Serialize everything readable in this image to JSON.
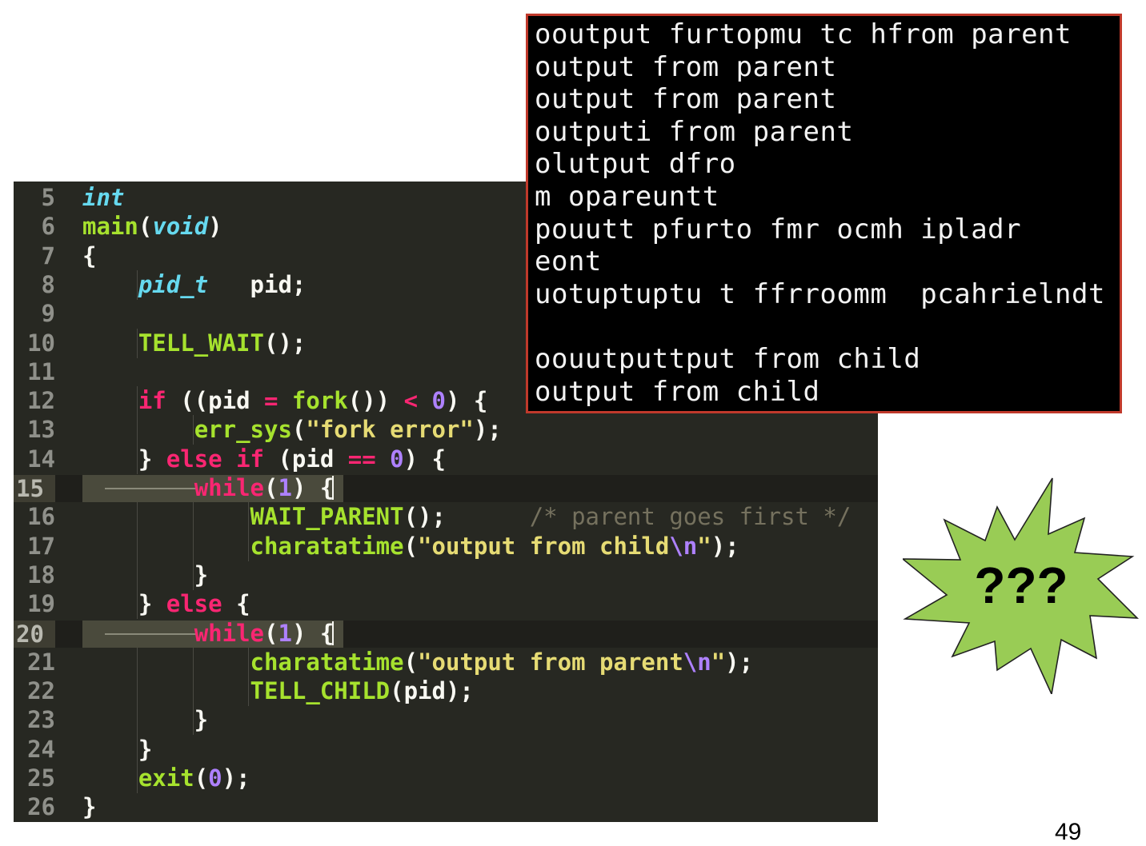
{
  "editor": {
    "lines": [
      {
        "num": "5",
        "tokens": [
          [
            "ty",
            "int"
          ]
        ]
      },
      {
        "num": "6",
        "tokens": [
          [
            "fn",
            "main"
          ],
          [
            "tw",
            "("
          ],
          [
            "ty",
            "void"
          ],
          [
            "tw",
            ")"
          ]
        ]
      },
      {
        "num": "7",
        "tokens": [
          [
            "tw",
            "{"
          ]
        ]
      },
      {
        "num": "8",
        "tokens": [
          [
            "tw",
            "    "
          ],
          [
            "ty",
            "pid_t"
          ],
          [
            "tw",
            "   pid;"
          ]
        ]
      },
      {
        "num": "9",
        "tokens": []
      },
      {
        "num": "10",
        "tokens": [
          [
            "tw",
            "    "
          ],
          [
            "fn",
            "TELL_WAIT"
          ],
          [
            "tw",
            "();"
          ]
        ]
      },
      {
        "num": "11",
        "tokens": []
      },
      {
        "num": "12",
        "tokens": [
          [
            "tw",
            "    "
          ],
          [
            "kw",
            "if"
          ],
          [
            "tw",
            " ((pid "
          ],
          [
            "kw",
            "="
          ],
          [
            "tw",
            " "
          ],
          [
            "fn",
            "fork"
          ],
          [
            "tw",
            "()) "
          ],
          [
            "kw",
            "<"
          ],
          [
            "tw",
            " "
          ],
          [
            "num",
            "0"
          ],
          [
            "tw",
            ") {"
          ]
        ]
      },
      {
        "num": "13",
        "tokens": [
          [
            "tw",
            "        "
          ],
          [
            "fn",
            "err_sys"
          ],
          [
            "tw",
            "("
          ],
          [
            "str",
            "\"fork error\""
          ],
          [
            "tw",
            ");"
          ]
        ]
      },
      {
        "num": "14",
        "tokens": [
          [
            "tw",
            "    } "
          ],
          [
            "kw",
            "else if"
          ],
          [
            "tw",
            " (pid "
          ],
          [
            "kw",
            "=="
          ],
          [
            "tw",
            " "
          ],
          [
            "num",
            "0"
          ],
          [
            "tw",
            ") {"
          ]
        ]
      },
      {
        "num": "15",
        "hl": true,
        "tokens": [
          [
            "tw",
            "        "
          ],
          [
            "kw",
            "while"
          ],
          [
            "tw",
            "("
          ],
          [
            "num",
            "1"
          ],
          [
            "tw",
            ") {"
          ]
        ]
      },
      {
        "num": "16",
        "tokens": [
          [
            "tw",
            "            "
          ],
          [
            "fn",
            "WAIT_PARENT"
          ],
          [
            "tw",
            "();      "
          ],
          [
            "cmt",
            "/* parent goes first */"
          ]
        ]
      },
      {
        "num": "17",
        "tokens": [
          [
            "tw",
            "            "
          ],
          [
            "fn",
            "charatatime"
          ],
          [
            "tw",
            "("
          ],
          [
            "str",
            "\"output from child"
          ],
          [
            "esc",
            "\\n"
          ],
          [
            "str",
            "\""
          ],
          [
            "tw",
            ");"
          ]
        ]
      },
      {
        "num": "18",
        "tokens": [
          [
            "tw",
            "        }"
          ]
        ]
      },
      {
        "num": "19",
        "tokens": [
          [
            "tw",
            "    } "
          ],
          [
            "kw",
            "else"
          ],
          [
            "tw",
            " {"
          ]
        ]
      },
      {
        "num": "20",
        "hl": true,
        "tokens": [
          [
            "tw",
            "        "
          ],
          [
            "kw",
            "while"
          ],
          [
            "tw",
            "("
          ],
          [
            "num",
            "1"
          ],
          [
            "tw",
            ") {"
          ]
        ]
      },
      {
        "num": "21",
        "tokens": [
          [
            "tw",
            "            "
          ],
          [
            "fn",
            "charatatime"
          ],
          [
            "tw",
            "("
          ],
          [
            "str",
            "\"output from parent"
          ],
          [
            "esc",
            "\\n"
          ],
          [
            "str",
            "\""
          ],
          [
            "tw",
            ");"
          ]
        ]
      },
      {
        "num": "22",
        "tokens": [
          [
            "tw",
            "            "
          ],
          [
            "fn",
            "TELL_CHILD"
          ],
          [
            "tw",
            "(pid);"
          ]
        ]
      },
      {
        "num": "23",
        "tokens": [
          [
            "tw",
            "        }"
          ]
        ]
      },
      {
        "num": "24",
        "tokens": [
          [
            "tw",
            "    }"
          ]
        ]
      },
      {
        "num": "25",
        "tokens": [
          [
            "tw",
            "    "
          ],
          [
            "fn",
            "exit"
          ],
          [
            "tw",
            "("
          ],
          [
            "num",
            "0"
          ],
          [
            "tw",
            ");"
          ]
        ]
      },
      {
        "num": "26",
        "tokens": [
          [
            "tw",
            "}"
          ]
        ]
      }
    ]
  },
  "terminal": {
    "lines": [
      "ooutput furtopmu tc hfrom parent",
      "output from parent",
      "output from parent",
      "outputi from parent",
      "olutput dfro",
      "m opareuntt",
      "pouutt pfurto fmr ocmh ipladr",
      "eont",
      "uotuptuptu t ffrroomm  pcahrielndt",
      "",
      "oouutputtput from child",
      "output from child"
    ]
  },
  "burst": {
    "text": "???",
    "fill": "#99cc55"
  },
  "page_number": "49",
  "colors": {
    "editor_bg": "#272822",
    "terminal_bg": "#000000",
    "terminal_border": "#c0392b"
  }
}
